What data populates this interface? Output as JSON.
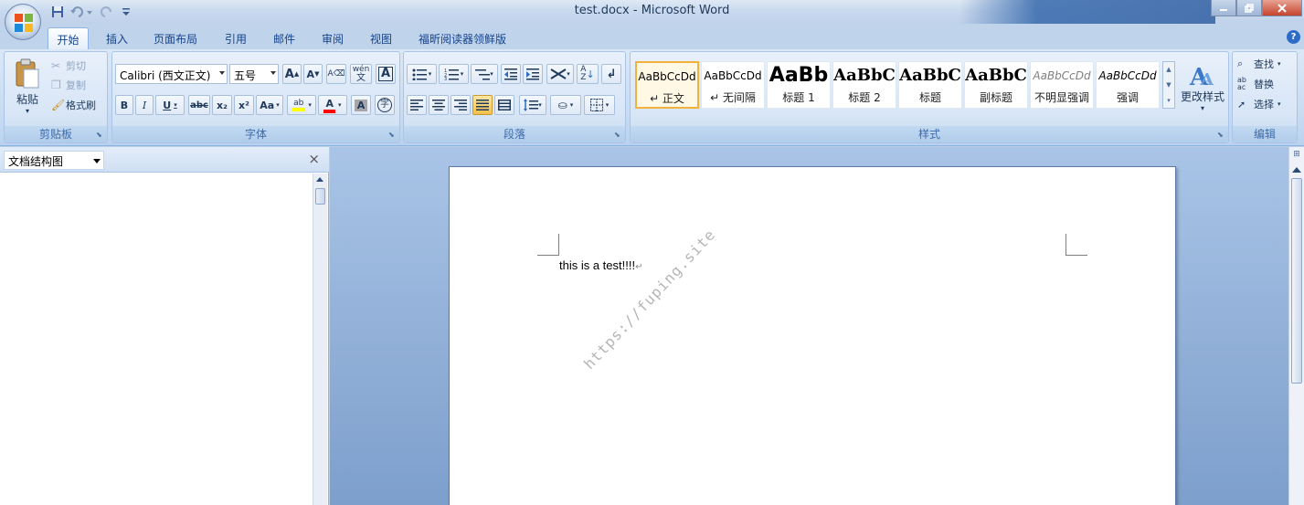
{
  "window": {
    "title": "test.docx - Microsoft Word",
    "controls": [
      "–",
      "❐",
      "✕"
    ]
  },
  "quick_access": [
    "save-icon",
    "undo-icon",
    "redo-icon",
    "customize-icon"
  ],
  "tabs": [
    {
      "label": "开始",
      "active": true
    },
    {
      "label": "插入"
    },
    {
      "label": "页面布局"
    },
    {
      "label": "引用"
    },
    {
      "label": "邮件"
    },
    {
      "label": "审阅"
    },
    {
      "label": "视图"
    },
    {
      "label": "福昕阅读器领鲜版"
    }
  ],
  "help_label": "?",
  "clipboard": {
    "group_label": "剪贴板",
    "paste": "粘贴",
    "cut": "剪切",
    "copy": "复制",
    "format_painter": "格式刷"
  },
  "font": {
    "group_label": "字体",
    "font_name": "Calibri (西文正文)",
    "font_size": "五号",
    "bold": "B",
    "italic": "I",
    "underline": "U",
    "strike": "abc",
    "subscript": "x₂",
    "superscript": "x²",
    "change_case": "Aa",
    "grow": "A",
    "shrink": "A",
    "phonetic": "wén",
    "char_border": "A",
    "char_shading": "A",
    "enclose": "字",
    "highlight_color": "#ffff00",
    "font_color": "#ff0000"
  },
  "paragraph": {
    "group_label": "段落"
  },
  "styles": {
    "group_label": "样式",
    "items": [
      {
        "sample": "AaBbCcDd",
        "name": "↵ 正文",
        "selected": true
      },
      {
        "sample": "AaBbCcDd",
        "name": "↵ 无间隔"
      },
      {
        "sample": "AaBb",
        "name": "标题 1"
      },
      {
        "sample": "AaBbC",
        "name": "标题 2"
      },
      {
        "sample": "AaBbC",
        "name": "标题"
      },
      {
        "sample": "AaBbC",
        "name": "副标题"
      },
      {
        "sample": "AaBbCcDd",
        "name": "不明显强调"
      },
      {
        "sample": "AaBbCcDd",
        "name": "强调"
      }
    ],
    "change_styles": "更改样式"
  },
  "editing": {
    "group_label": "编辑",
    "find": "查找",
    "replace": "替换",
    "select": "选择"
  },
  "nav_pane": {
    "view_select": "文档结构图",
    "close": "×"
  },
  "document": {
    "text": "this is a test!!!!",
    "paragraph_mark": "↵",
    "watermark": "https://fuping.site"
  }
}
